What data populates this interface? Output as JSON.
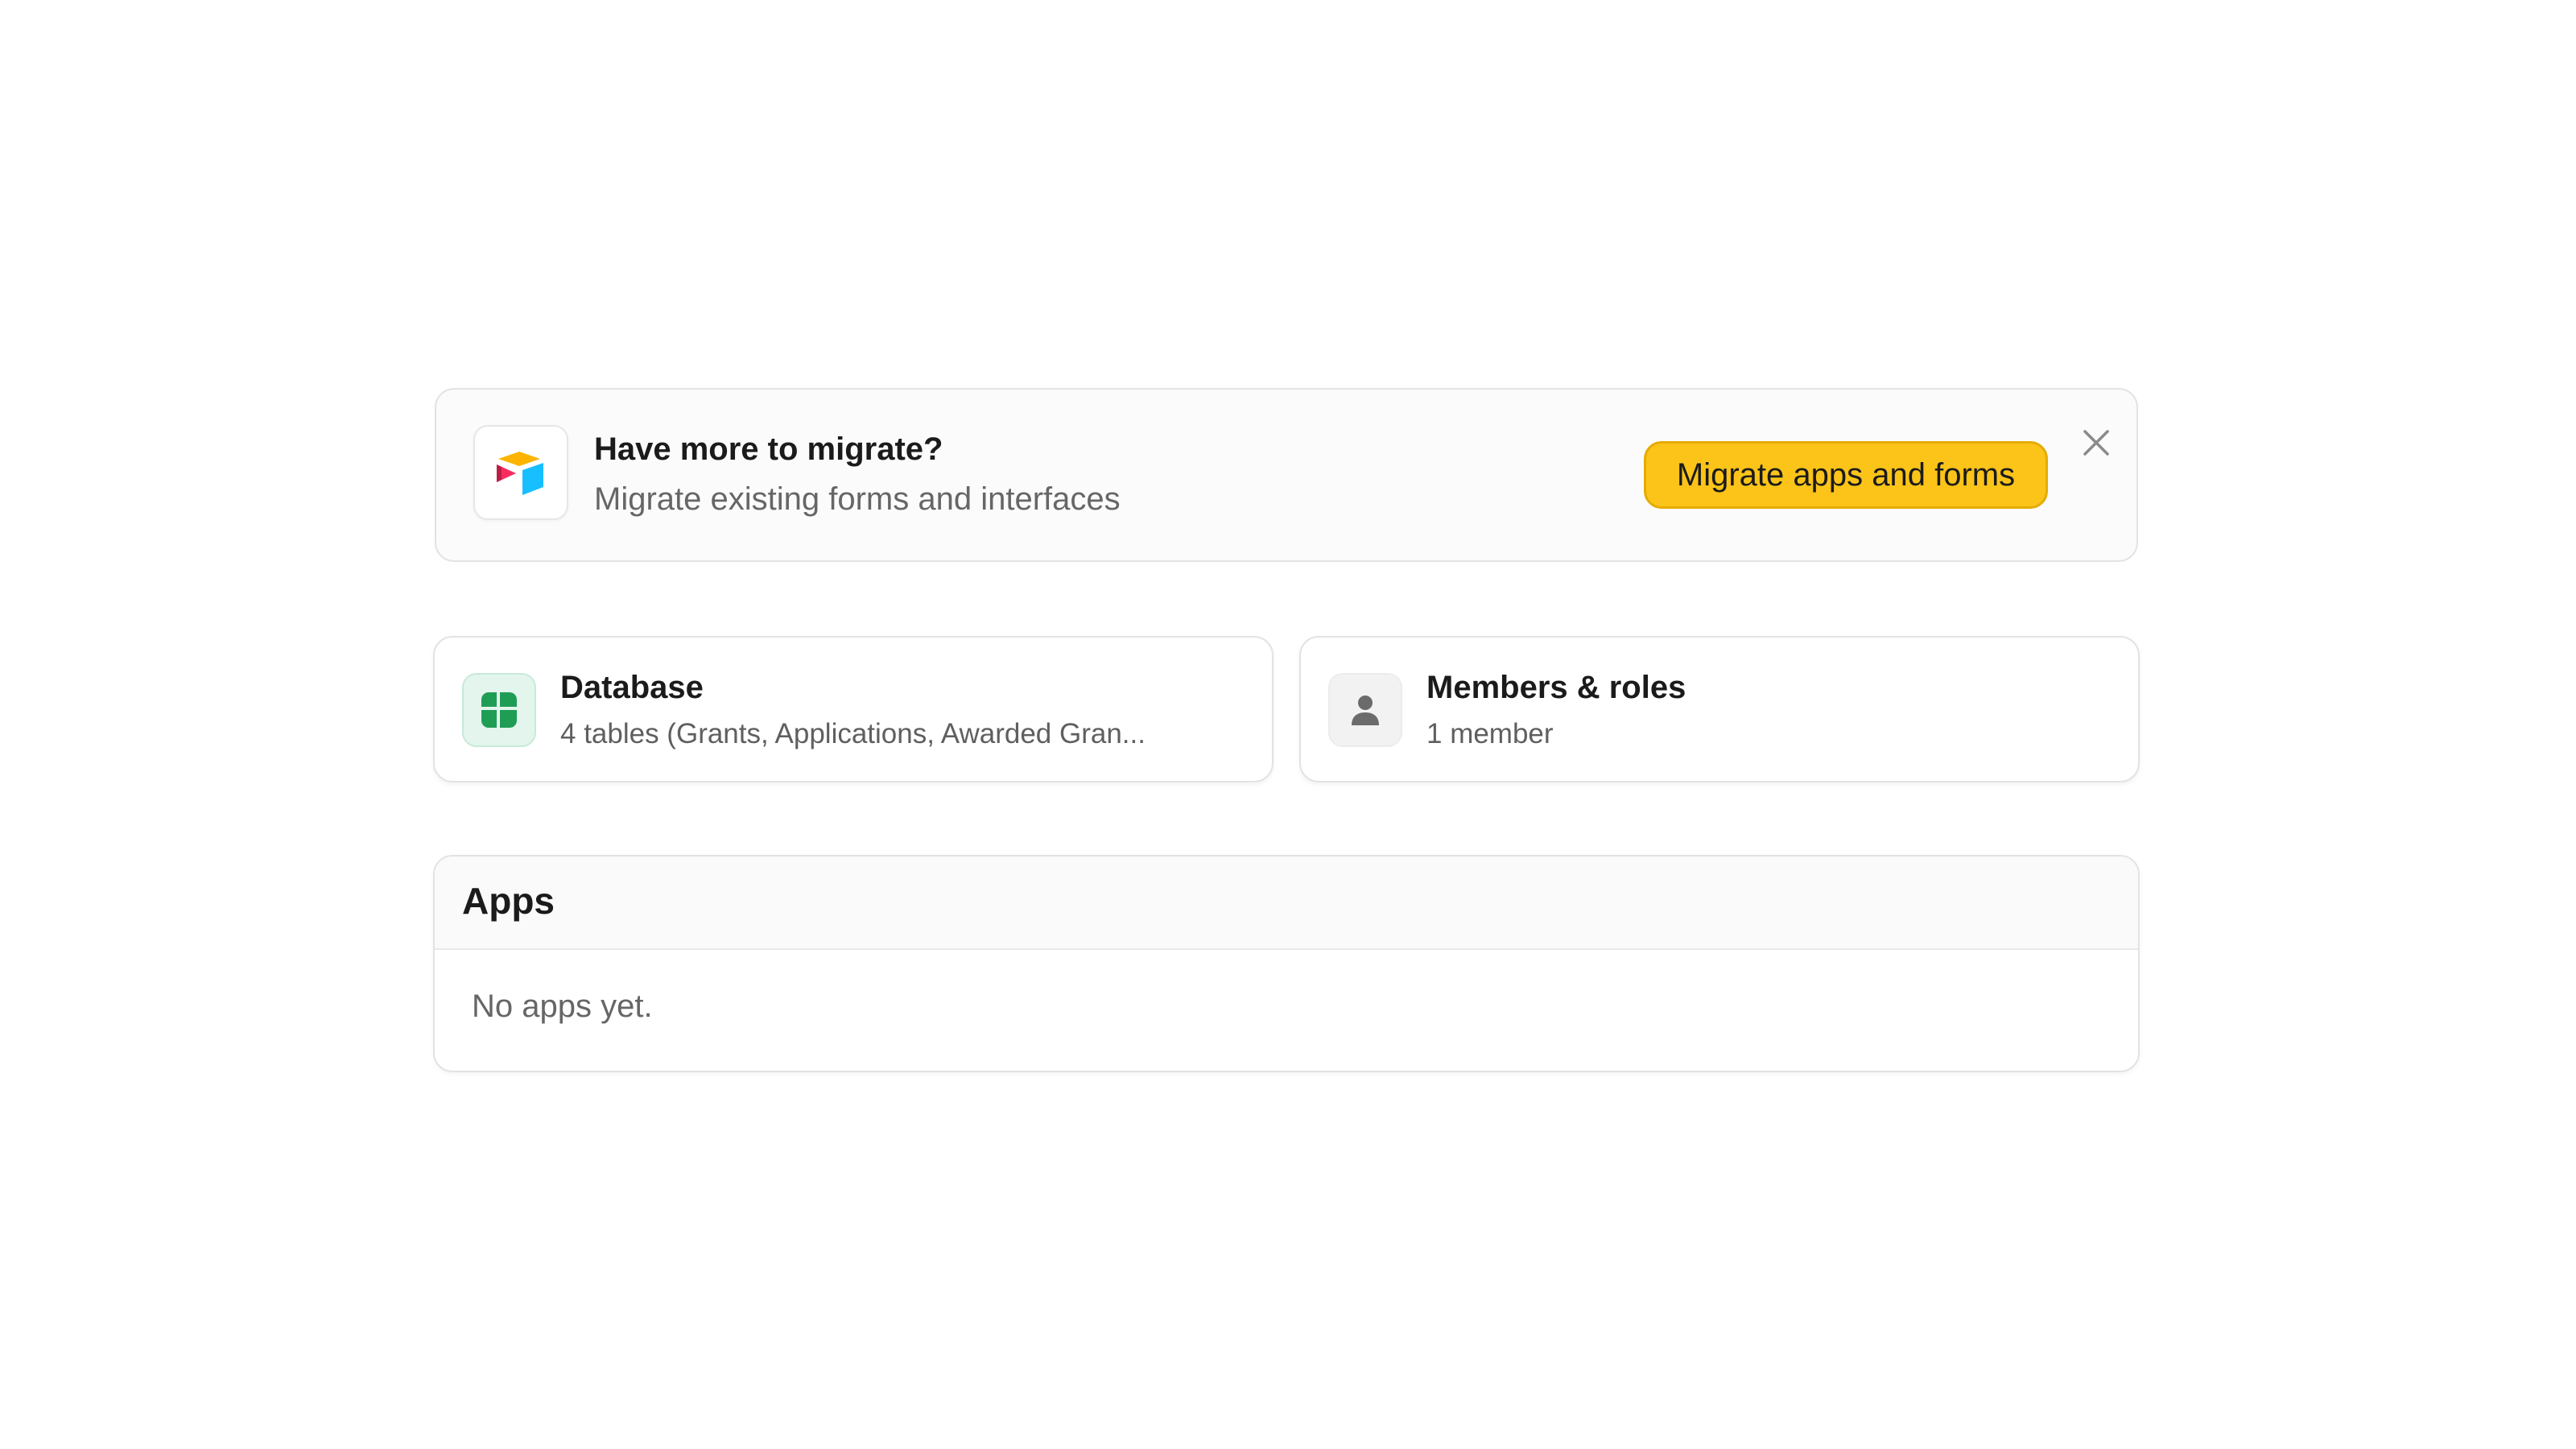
{
  "banner": {
    "logo_icon": "airtable-logo-icon",
    "title": "Have more to migrate?",
    "subtitle": "Migrate existing forms and interfaces",
    "action_label": "Migrate apps and forms",
    "close_icon": "close-icon",
    "action_color": "#fcc419"
  },
  "cards": {
    "database": {
      "icon": "table-grid-icon",
      "title": "Database",
      "subtitle": "4 tables (Grants, Applications, Awarded Gran...",
      "icon_color": "#1f9d55"
    },
    "members": {
      "icon": "person-icon",
      "title": "Members & roles",
      "subtitle": "1 member",
      "icon_color": "#6b6b6b"
    }
  },
  "apps": {
    "title": "Apps",
    "empty_message": "No apps yet."
  }
}
